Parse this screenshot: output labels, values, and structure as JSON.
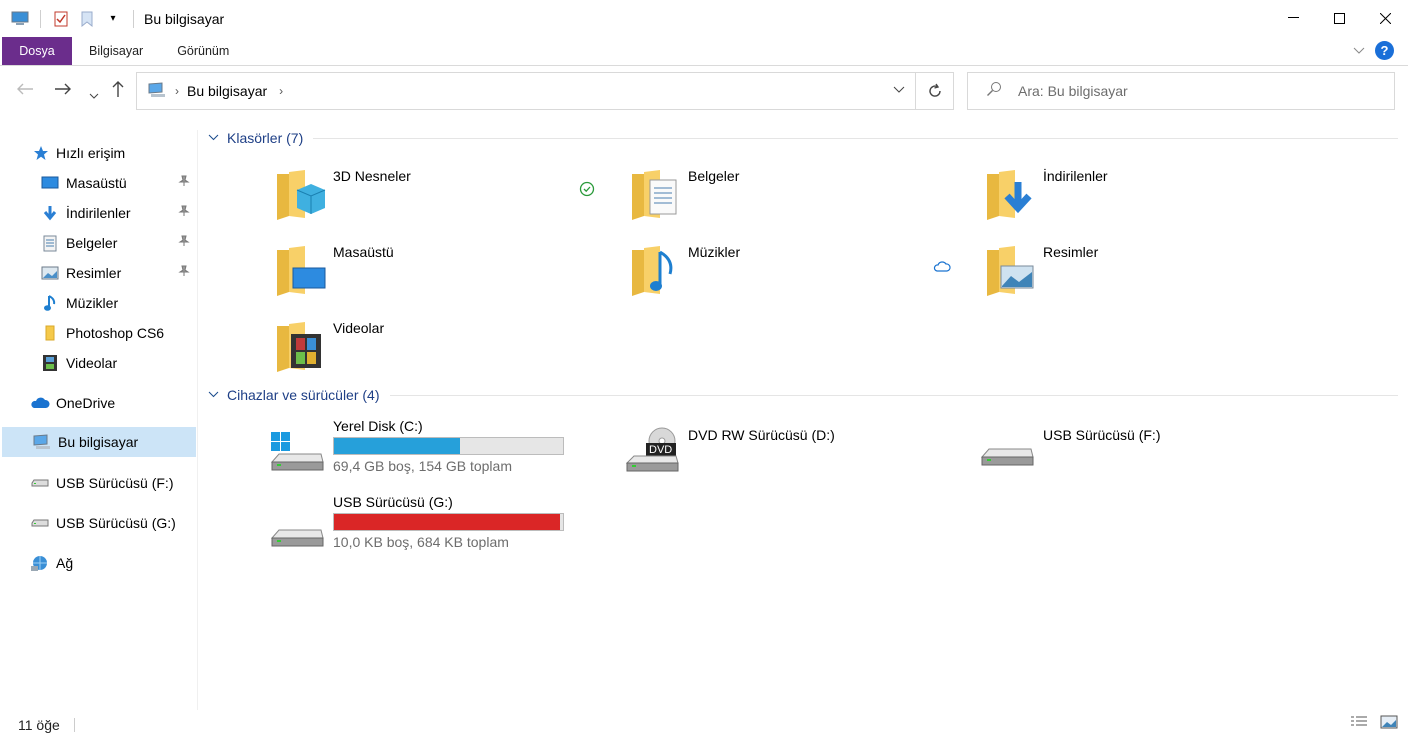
{
  "window": {
    "title": "Bu bilgisayar"
  },
  "ribbon": {
    "tabs": [
      "Dosya",
      "Bilgisayar",
      "Görünüm"
    ]
  },
  "address": {
    "crumb": "Bu bilgisayar"
  },
  "search": {
    "placeholder": "Ara: Bu bilgisayar"
  },
  "nav": {
    "quick_access": "Hızlı erişim",
    "items": [
      {
        "label": "Masaüstü",
        "pinned": true
      },
      {
        "label": "İndirilenler",
        "pinned": true
      },
      {
        "label": "Belgeler",
        "pinned": true
      },
      {
        "label": "Resimler",
        "pinned": true
      },
      {
        "label": "Müzikler",
        "pinned": false
      },
      {
        "label": "Photoshop CS6",
        "pinned": false
      },
      {
        "label": "Videolar",
        "pinned": false
      }
    ],
    "onedrive": "OneDrive",
    "this_pc": "Bu bilgisayar",
    "usb_f": "USB Sürücüsü (F:)",
    "usb_g": "USB Sürücüsü (G:)",
    "network": "Ağ"
  },
  "folders": {
    "title": "Klasörler (7)",
    "items": [
      "3D Nesneler",
      "Belgeler",
      "İndirilenler",
      "Masaüstü",
      "Müzikler",
      "Resimler",
      "Videolar"
    ]
  },
  "devices": {
    "title": "Cihazlar ve sürücüler (4)",
    "c": {
      "name": "Yerel Disk (C:)",
      "free": "69,4 GB boş, 154 GB toplam",
      "used_fraction": 0.55,
      "color": "#26a0da"
    },
    "d": {
      "name": "DVD RW Sürücüsü (D:)"
    },
    "f": {
      "name": "USB Sürücüsü (F:)"
    },
    "g": {
      "name": "USB Sürücüsü (G:)",
      "free": "10,0 KB boş, 684 KB toplam",
      "used_fraction": 0.985,
      "color": "#da2626"
    }
  },
  "status": {
    "count": "11 öğe"
  },
  "colors": {
    "accent": "#6b2d8c",
    "group_title": "#1e3f86",
    "selection": "#cce4f7"
  }
}
